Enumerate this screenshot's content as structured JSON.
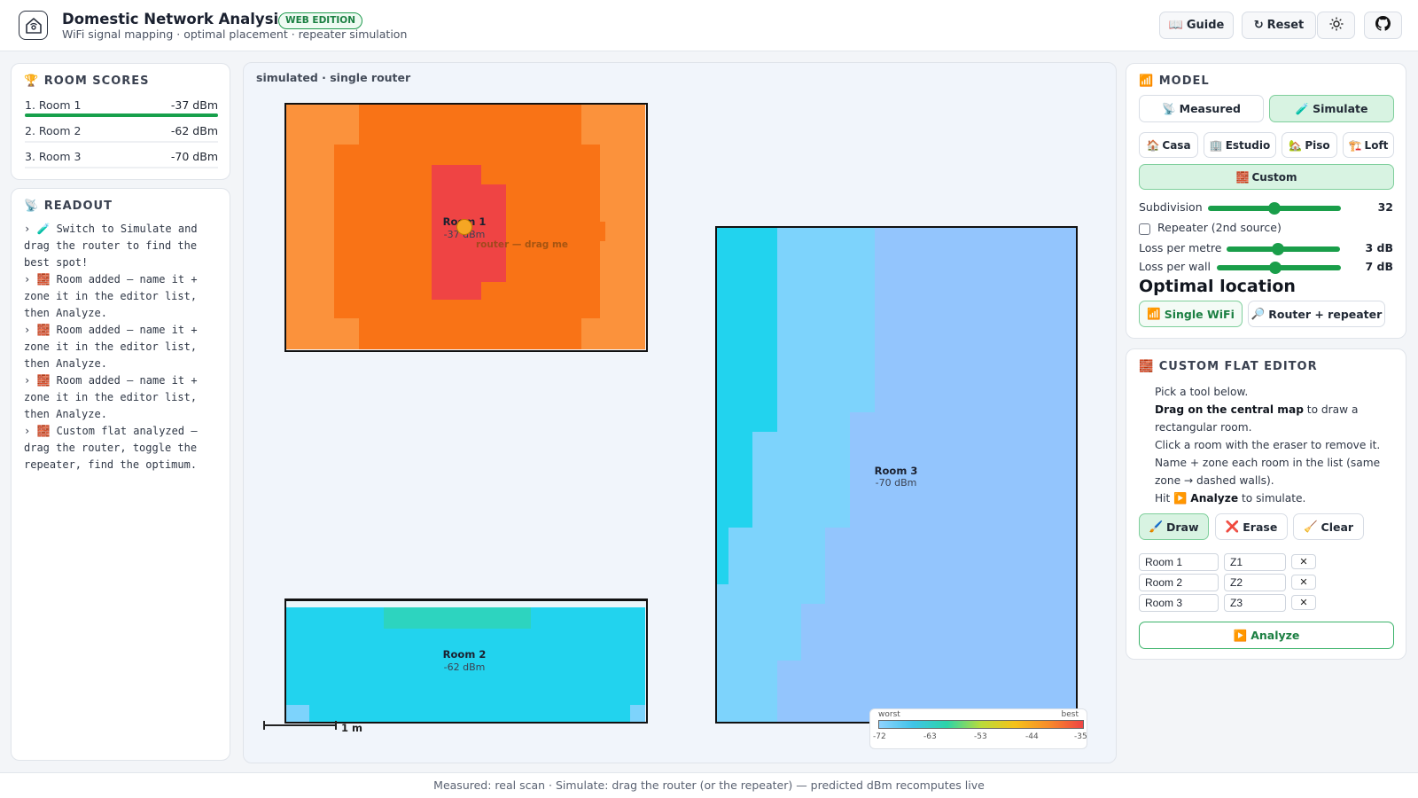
{
  "app": {
    "title": "Domestic Network Analysis",
    "edition_badge": "WEB EDITION",
    "subtitle": "WiFi signal mapping · optimal placement · repeater simulation"
  },
  "header_buttons": {
    "guide": "Guide",
    "reset": "Reset"
  },
  "icons": {
    "logo": "house-router-icon",
    "guide": "book-icon",
    "reset": "refresh-icon",
    "theme": "sun-icon",
    "github": "github-icon"
  },
  "room_scores": {
    "title": "ROOM SCORES",
    "rows": [
      {
        "name": "1. Room 1",
        "value": "-37 dBm",
        "fraction": 1.0
      },
      {
        "name": "2. Room 2",
        "value": "-62 dBm",
        "fraction": 0
      },
      {
        "name": "3. Room 3",
        "value": "-70 dBm",
        "fraction": 0
      }
    ]
  },
  "readout": {
    "title": "READOUT",
    "lines": [
      "› 🧪 Switch to Simulate and drag the router to find the best spot!",
      "› 🧱 Room added — name it + zone it in the editor list, then Analyze.",
      "› 🧱 Room added — name it + zone it in the editor list, then Analyze.",
      "› 🧱 Room added — name it + zone it in the editor list, then Analyze.",
      "› 🧱 Custom flat analyzed — drag the router, toggle the repeater, find the optimum."
    ]
  },
  "map": {
    "mode_label": "simulated · single router",
    "router_label": "router — drag me",
    "scale_label": "1 m",
    "rooms": [
      {
        "name": "Room 1",
        "dbm": "-37 dBm"
      },
      {
        "name": "Room 2",
        "dbm": "-62 dBm"
      },
      {
        "name": "Room 3",
        "dbm": "-70 dBm"
      }
    ],
    "legend": {
      "worst": "worst",
      "best": "best",
      "ticks": [
        "-72",
        "-63",
        "-53",
        "-44",
        "-35"
      ]
    },
    "colors": {
      "strong": "#ef4444",
      "good": "#f97316",
      "fair": "#fb923c",
      "weak_cyan": "#22d3ee",
      "weak_teal": "#2dd4bf",
      "poor": "#7dd3fc",
      "worst": "#93c5fd"
    }
  },
  "model": {
    "title": "MODEL",
    "modes": [
      "Measured",
      "Simulate"
    ],
    "active_mode": "Simulate",
    "presets": [
      "Casa",
      "Estudio",
      "Piso",
      "Loft"
    ],
    "custom_preset": "Custom",
    "subdivision": {
      "label": "Subdivision",
      "value": "32",
      "fraction": 0.5
    },
    "repeater": {
      "label": "Repeater (2nd source)",
      "checked": false
    },
    "loss_metre": {
      "label": "Loss per metre",
      "value": "3 dB",
      "fraction": 0.45
    },
    "loss_wall": {
      "label": "Loss per wall",
      "value": "7 dB",
      "fraction": 0.47
    },
    "optimal_heading": "Optimal location",
    "optimal_buttons": [
      "Single WiFi",
      "Router + repeater"
    ]
  },
  "editor": {
    "title": "CUSTOM FLAT EDITOR",
    "instr_1": "Pick a tool below.",
    "instr_2_bold": "Drag on the central map",
    "instr_2_rest": " to draw a rectangular room.",
    "instr_3": "Click a room with the eraser to remove it.",
    "instr_4": "Name + zone each room in the list (same zone → dashed walls).",
    "instr_5_pre": "Hit ▶️ ",
    "instr_5_bold": "Analyze",
    "instr_5_post": " to simulate.",
    "tools": [
      "Draw",
      "Erase",
      "Clear"
    ],
    "rooms": [
      {
        "name": "Room 1",
        "zone": "Z1"
      },
      {
        "name": "Room 2",
        "zone": "Z2"
      },
      {
        "name": "Room 3",
        "zone": "Z3"
      }
    ],
    "delete_label": "✕",
    "analyze_label": "Analyze"
  },
  "footer": "Measured: real scan · Simulate: drag the router (or the repeater) — predicted dBm recomputes live"
}
